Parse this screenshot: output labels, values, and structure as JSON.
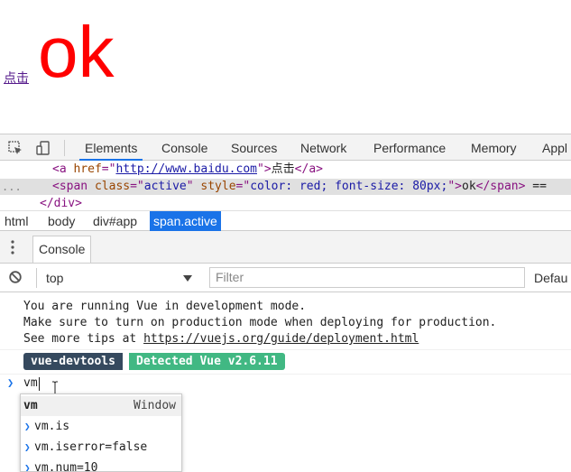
{
  "page": {
    "link_text": "点击",
    "ok_text": "ok"
  },
  "devtools": {
    "tabs": [
      "Elements",
      "Console",
      "Sources",
      "Network",
      "Performance",
      "Memory",
      "Appl"
    ],
    "active_tab": "Elements",
    "elements": {
      "line1": {
        "open": "<a ",
        "attr": "href",
        "eq": "=\"",
        "link": "http://www.baidu.com",
        "close": "\">",
        "text": "点击",
        "end": "</a>"
      },
      "line2": {
        "open": "<span ",
        "attr1": "class",
        "val1": "active",
        "attr2": "style",
        "val2": "color: red; font-size: 80px;",
        "close": "\">",
        "text": "ok",
        "end": "</span>",
        "tail": "=="
      },
      "line3": {
        "text": "</div>"
      },
      "dots": "..."
    },
    "breadcrumbs": [
      "html",
      "body",
      "div#app",
      "span.active"
    ],
    "drawer_tab": "Console",
    "console_toolbar": {
      "context": "top",
      "filter_placeholder": "Filter",
      "levels": "Defau"
    },
    "console": {
      "messages": [
        "You are running Vue in development mode.",
        "Make sure to turn on production mode when deploying for production.",
        "See more tips at "
      ],
      "tips_link": "https://vuejs.org/guide/deployment.html",
      "badge_left": "vue-devtools",
      "badge_right": "Detected Vue v2.6.11",
      "prompt_input": "vm"
    },
    "autocomplete": {
      "header_left": "vm",
      "header_right": "Window",
      "items": [
        "vm.is",
        "vm.iserror=false",
        "vm.num=10"
      ]
    }
  }
}
